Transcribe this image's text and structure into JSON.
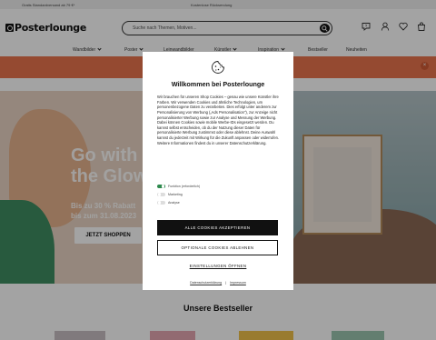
{
  "topbar": {
    "shipping": "Gratis Standardversand ab 79 €*",
    "returns": "Kostenlose Rücksendung"
  },
  "header": {
    "logo": "Posterlounge",
    "search_placeholder": "Suche nach Themen, Motiven..."
  },
  "nav": {
    "items": [
      {
        "label": "Wandbilder"
      },
      {
        "label": "Poster"
      },
      {
        "label": "Leinwandbilder"
      },
      {
        "label": "Künstler"
      },
      {
        "label": "Inspiration"
      },
      {
        "label": "Bestseller"
      },
      {
        "label": "Neuheiten"
      }
    ]
  },
  "hero": {
    "title_line1": "Go with",
    "title_line2": "the Glow",
    "subtitle_line1": "Bis zu 30 % Rabatt",
    "subtitle_line2": "bis zum 31.08.2023",
    "cta": "JETZT SHOPPEN"
  },
  "bestseller": {
    "heading": "Unsere Bestseller"
  },
  "cookie_modal": {
    "title": "Willkommen bei Posterlounge",
    "body": "Wir brauchen für unseren Shop Cookies – genau wie unsere Künstler ihre Farben. Wir verwenden Cookies und ähnliche Technologien, um personenbezogene Daten zu verarbeiten. Dies erfolgt unter anderem zur Personalisierung von Werbung („Ads Personalisation\"), zur Anzeige nicht personalisierter Werbung sowie zur Analyse und Messung der Werbung. Dabei können Cookies sowie mobile Werbe-IDs eingesetzt werden. Du kannst selbst entscheiden, ob du der Nutzung dieser Daten für personalisierte Werbung zustimmst oder diese ablehnst. Deine Auswahl kannst du jederzeit mit Wirkung für die Zukunft anpassen oder widerrufen. Weitere Informationen findest du in unserer Datenschutzerklärung.",
    "toggles": [
      {
        "label": "Funktion (erforderlich)",
        "state": "on"
      },
      {
        "label": "Marketing",
        "state": "off"
      },
      {
        "label": "Analyse",
        "state": "off"
      }
    ],
    "accept_label": "ALLE COOKIES AKZEPTIEREN",
    "decline_label": "OPTIONALE COOKIES ABLEHNEN",
    "settings_label": "EINSTELLUNGEN ÖFFNEN",
    "privacy_link": "Datenschutzerklärung",
    "separator": "|",
    "imprint_link": "Impressum"
  },
  "colors": {
    "promo_bar": "#e9744e",
    "toggle_on": "#2f8a4e",
    "button_dark": "#111111"
  },
  "icons": [
    "search-icon",
    "help-icon",
    "user-icon",
    "heart-icon",
    "cart-icon",
    "close-icon",
    "cookie-icon",
    "chevron-down-icon"
  ]
}
